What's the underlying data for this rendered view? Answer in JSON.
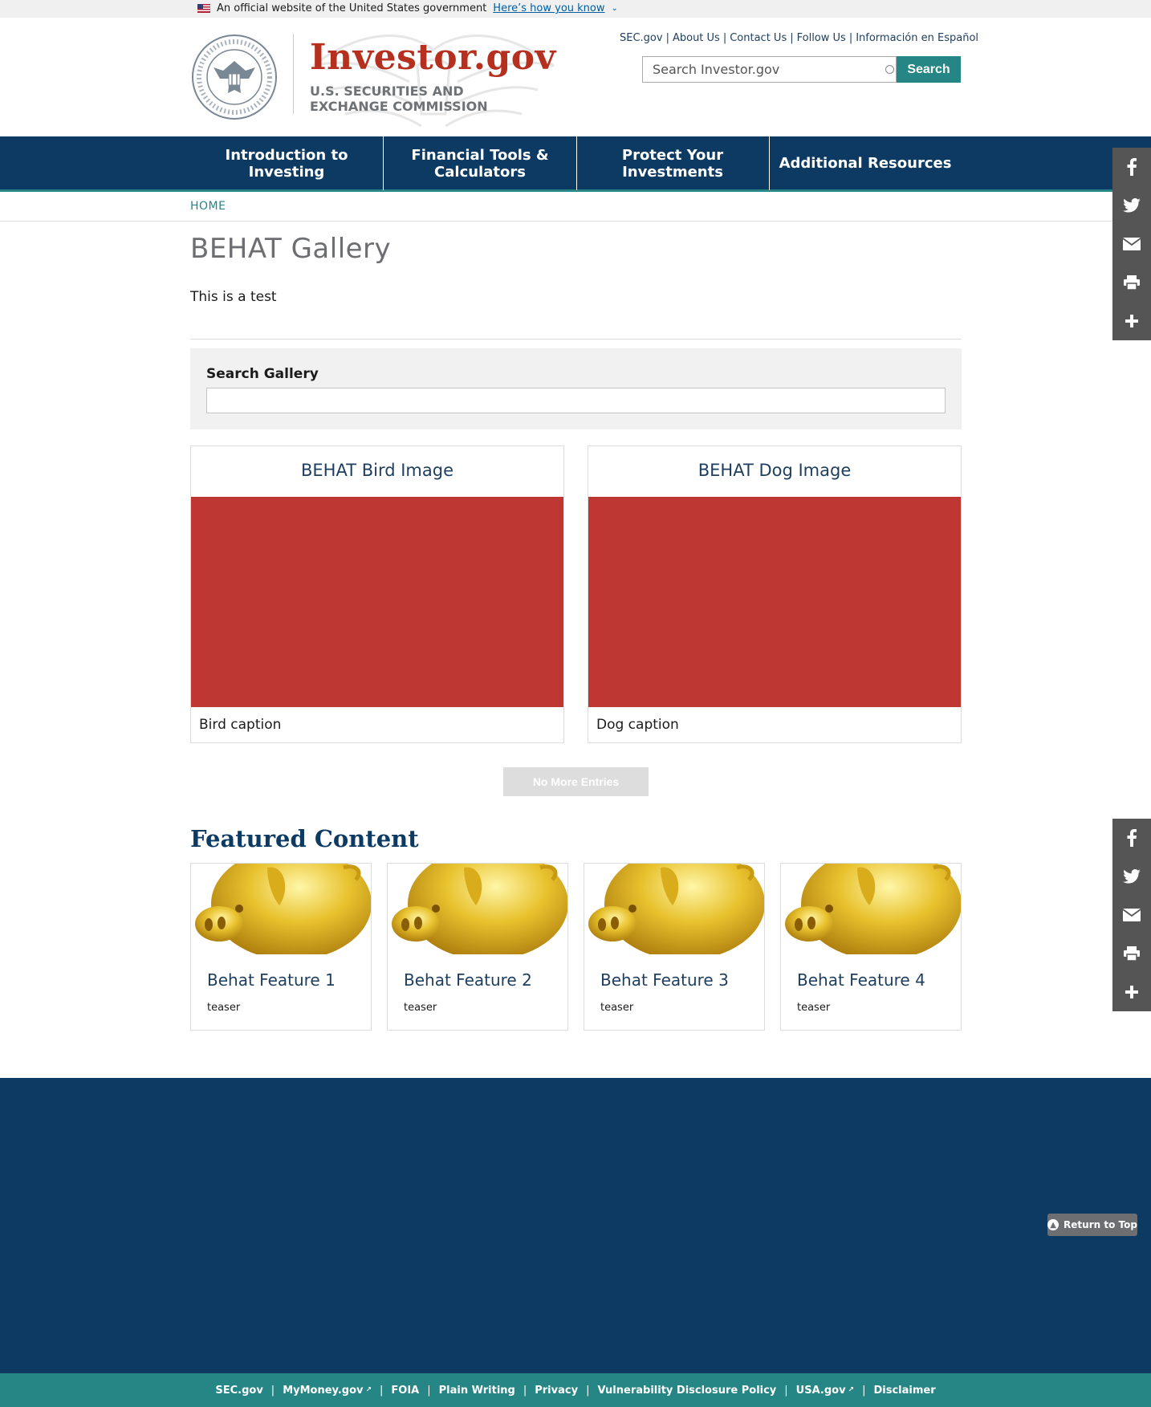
{
  "gov_banner": {
    "text": "An official website of the United States government",
    "link": "Here’s how you know"
  },
  "header": {
    "logo_title": "Investor.gov",
    "logo_subtitle": "U.S. SECURITIES AND EXCHANGE COMMISSION",
    "util_links": [
      "SEC.gov",
      "About Us",
      "Contact Us",
      "Follow Us",
      "Información en Español"
    ],
    "search_placeholder": "Search Investor.gov",
    "search_button": "Search"
  },
  "nav": {
    "items": [
      {
        "label": "Introduction to Investing"
      },
      {
        "label": "Financial Tools & Calculators"
      },
      {
        "label": "Protect Your Investments"
      },
      {
        "label": "Additional Resources"
      }
    ]
  },
  "breadcrumb": {
    "home": "HOME"
  },
  "page": {
    "title": "BEHAT Gallery",
    "intro": "This is a test"
  },
  "search_gallery": {
    "label": "Search Gallery"
  },
  "gallery": {
    "items": [
      {
        "title": "BEHAT Bird Image",
        "caption": "Bird caption"
      },
      {
        "title": "BEHAT Dog Image",
        "caption": "Dog caption"
      }
    ],
    "more_button": "No More Entries"
  },
  "featured": {
    "heading": "Featured Content",
    "items": [
      {
        "title": "Behat Feature 1",
        "teaser": "teaser"
      },
      {
        "title": "Behat Feature 2",
        "teaser": "teaser"
      },
      {
        "title": "Behat Feature 3",
        "teaser": "teaser"
      },
      {
        "title": "Behat Feature 4",
        "teaser": "teaser"
      }
    ]
  },
  "colors": {
    "brand_red": "#b5301f",
    "nav_blue": "#0c3a63",
    "teal": "#268585",
    "image_placeholder": "#bf3732"
  },
  "social": [
    "facebook-icon",
    "twitter-icon",
    "email-icon",
    "print-icon",
    "plus-icon"
  ],
  "return_to_top": "Return to Top",
  "subfooter": {
    "links": [
      "SEC.gov",
      "MyMoney.gov",
      "FOIA",
      "Plain Writing",
      "Privacy",
      "Vulnerability Disclosure Policy",
      "USA.gov",
      "Disclaimer"
    ]
  }
}
